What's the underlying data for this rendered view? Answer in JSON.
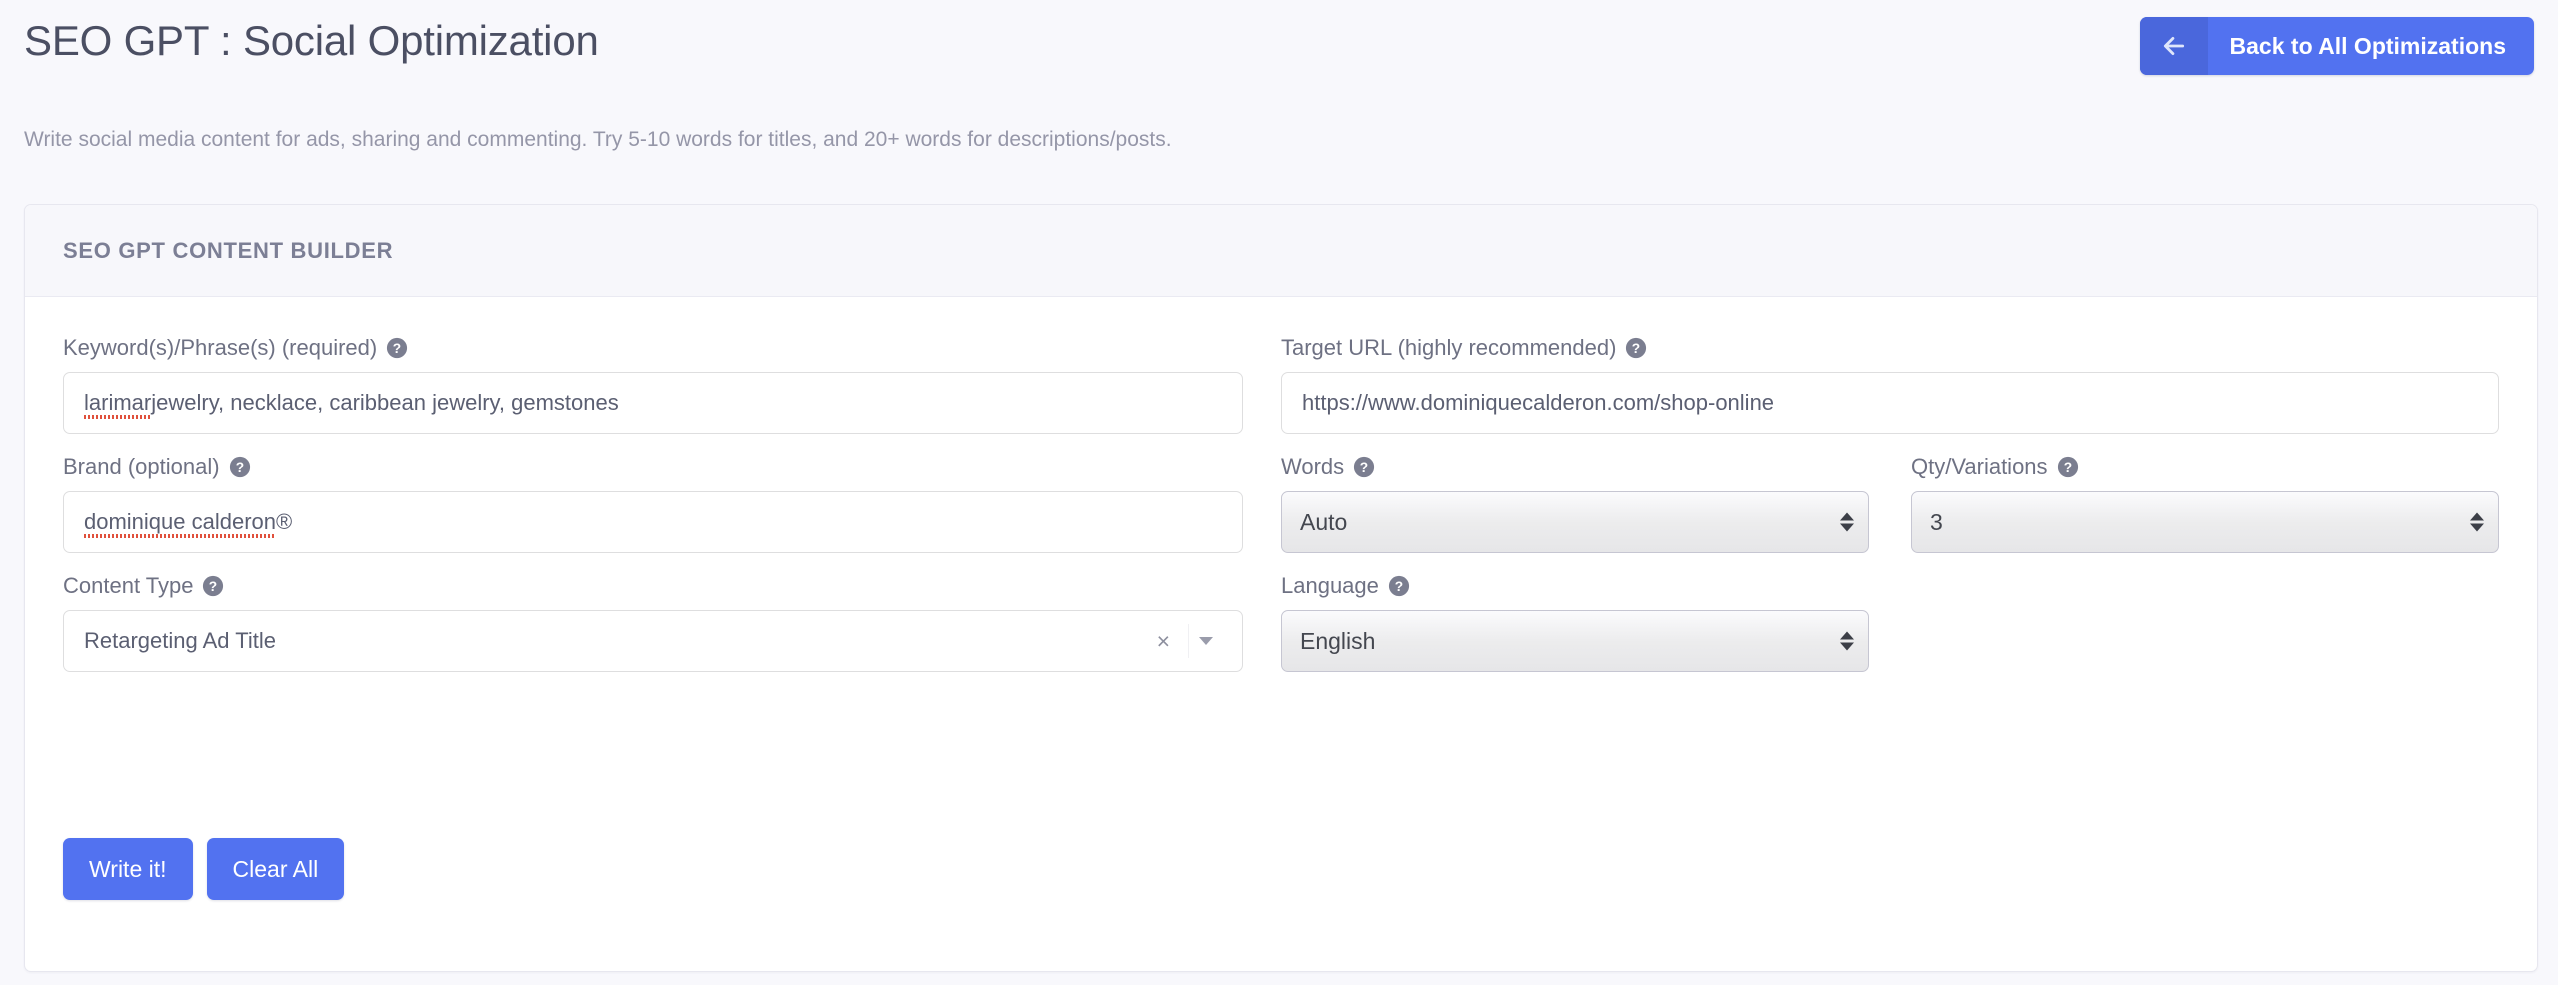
{
  "header": {
    "title": "SEO GPT : Social Optimization",
    "back_button": {
      "label": "Back to All Optimizations",
      "icon": "arrow-left-icon",
      "bg": "#5272f0",
      "icon_bg": "#4a67dc"
    }
  },
  "subtitle": "Write social media content for ads, sharing and commenting. Try 5-10 words for titles, and 20+ words for descriptions/posts.",
  "card": {
    "header_title": "SEO GPT CONTENT BUILDER"
  },
  "fields": {
    "keywords": {
      "label": "Keyword(s)/Phrase(s) (required)",
      "help_icon": "help-circle-icon",
      "value": "larimar jewelry, necklace, caribbean jewelry, gemstones",
      "misspelled_word": "larimar",
      "rest_value": " jewelry, necklace, caribbean jewelry, gemstones",
      "placeholder": ""
    },
    "brand": {
      "label": "Brand (optional)",
      "help_icon": "help-circle-icon",
      "value": "dominique calderon ®",
      "misspelled_word": "dominique calderon",
      "rest_value": " ®",
      "placeholder": ""
    },
    "content_type": {
      "label": "Content Type",
      "help_icon": "help-circle-icon",
      "value": "Retargeting Ad Title",
      "clear_icon": "close-x-icon",
      "caret_icon": "chevron-down-icon"
    },
    "target_url": {
      "label": "Target URL (highly recommended)",
      "help_icon": "help-circle-icon",
      "value": "https://www.dominiquecalderon.com/shop-online",
      "placeholder": ""
    },
    "words": {
      "label": "Words",
      "help_icon": "help-circle-icon",
      "value": "Auto"
    },
    "qty_variations": {
      "label": "Qty/Variations",
      "help_icon": "help-circle-icon",
      "value": "3"
    },
    "language": {
      "label": "Language",
      "help_icon": "help-circle-icon",
      "value": "English"
    }
  },
  "actions": {
    "write_label": "Write it!",
    "clear_label": "Clear All",
    "button_color": "#5272f0"
  }
}
